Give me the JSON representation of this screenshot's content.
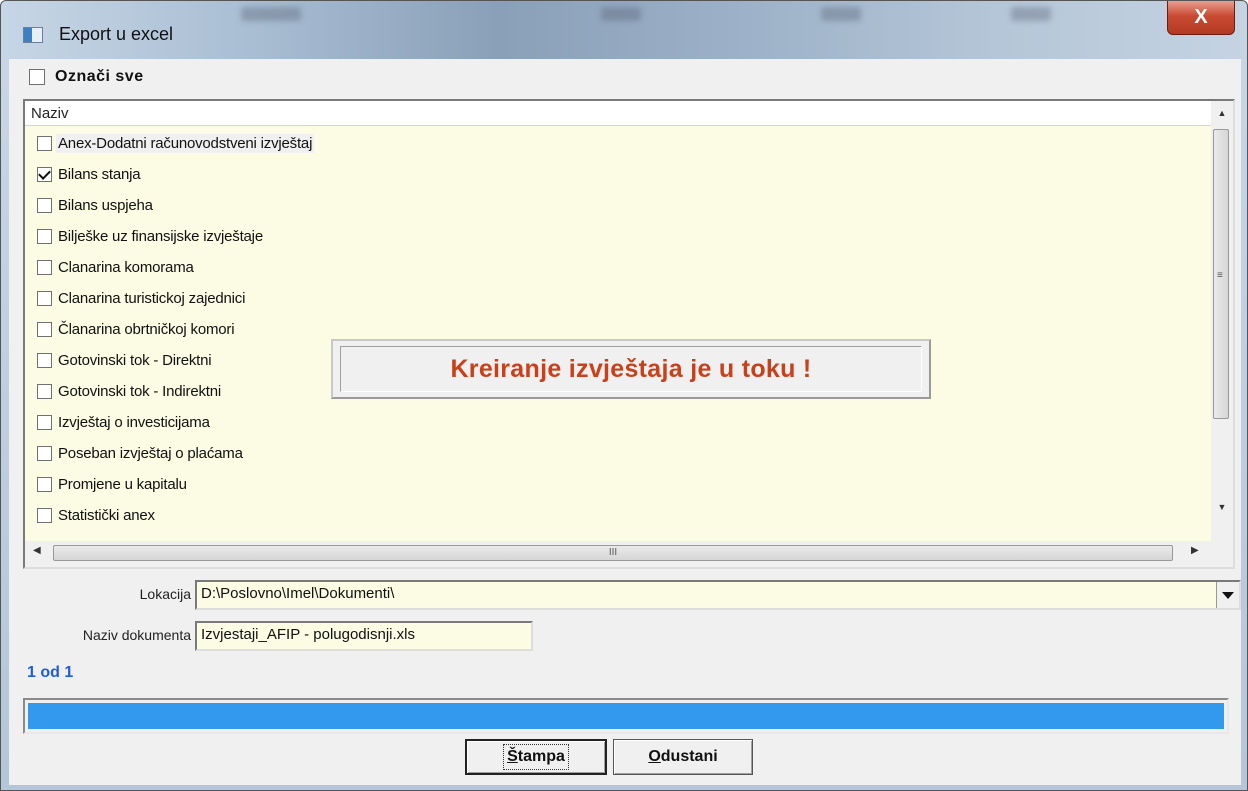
{
  "window": {
    "title": "Export u excel",
    "close_glyph": "X"
  },
  "select_all": {
    "label": "Označi sve",
    "checked": false
  },
  "list": {
    "header": "Naziv",
    "items": [
      {
        "label": "Anex-Dodatni računovodstveni izvještaj",
        "checked": false
      },
      {
        "label": "Bilans stanja",
        "checked": true
      },
      {
        "label": "Bilans uspjeha",
        "checked": false
      },
      {
        "label": "Bilješke uz finansijske izvještaje",
        "checked": false
      },
      {
        "label": "Clanarina komorama",
        "checked": false
      },
      {
        "label": "Clanarina turistickoj zajednici",
        "checked": false
      },
      {
        "label": "Članarina obrtničkoj komori",
        "checked": false
      },
      {
        "label": "Gotovinski tok - Direktni",
        "checked": false
      },
      {
        "label": "Gotovinski tok - Indirektni",
        "checked": false
      },
      {
        "label": "Izvještaj o investicijama",
        "checked": false
      },
      {
        "label": "Poseban izvještaj o plaćama",
        "checked": false
      },
      {
        "label": "Promjene u kapitalu",
        "checked": false
      },
      {
        "label": "Statistički anex",
        "checked": false
      }
    ],
    "hscroll_grip": "III",
    "vscroll_grip": "≡"
  },
  "status_popup": {
    "text": "Kreiranje izvještaja je u toku !"
  },
  "location": {
    "label": "Lokacija",
    "value": "D:\\Poslovno\\Imel\\Dokumenti\\"
  },
  "document_name": {
    "label": "Naziv dokumenta",
    "value": "Izvjestaji_AFIP - polugodisnji.xls"
  },
  "progress": {
    "counter": "1 od 1",
    "fraction": 1.0,
    "color": "#3399ee"
  },
  "buttons": {
    "print_first": "Š",
    "print_rest": "tampa",
    "cancel_first": "O",
    "cancel_rest": "dustani"
  },
  "colors": {
    "list_bg": "#fcfbe3",
    "status_text": "#c8411b",
    "counter_text": "#1d5ed8",
    "close_button": "#c94a32"
  }
}
